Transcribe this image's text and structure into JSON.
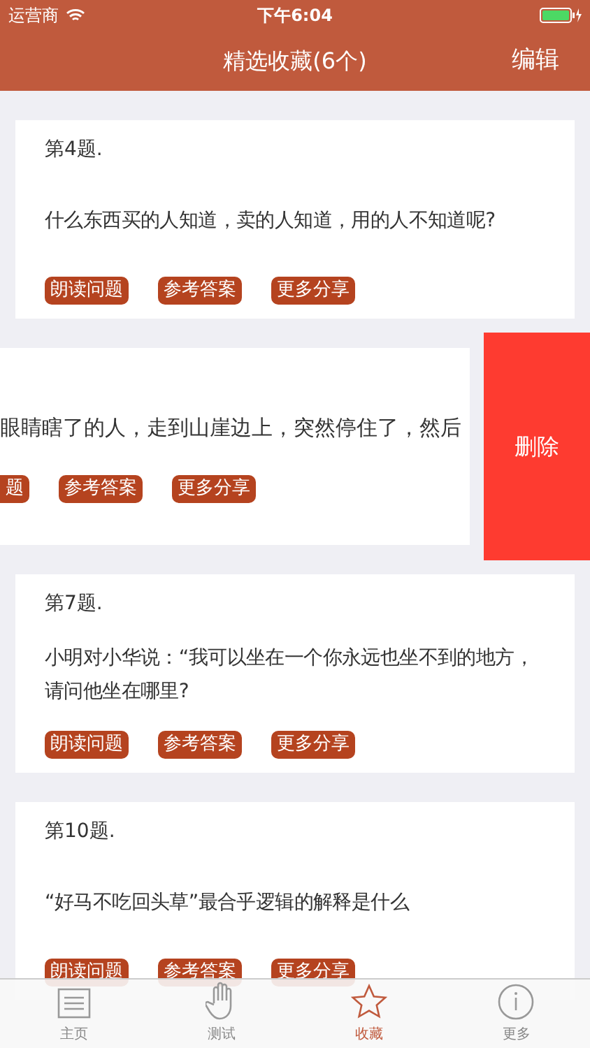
{
  "status_bar": {
    "carrier": "运营商",
    "time": "下午6:04"
  },
  "nav": {
    "title": "精选收藏(6个)",
    "action": "编辑"
  },
  "cards": [
    {
      "swiped": false,
      "title": "第4题.",
      "question": "什么东西买的人知道，卖的人知道，用的人不知道呢?",
      "buttons": [
        "朗读问题",
        "参考答案",
        "更多分享"
      ]
    },
    {
      "swiped": true,
      "question": "眼睛瞎了的人，走到山崖边上，突然停住了，然后",
      "buttons": [
        "题",
        "参考答案",
        "更多分享"
      ],
      "delete_label": "删除"
    },
    {
      "swiped": false,
      "title": "第7题.",
      "question": "小明对小华说：“我可以坐在一个你永远也坐不到的地方，请问他坐在哪里?",
      "buttons": [
        "朗读问题",
        "参考答案",
        "更多分享"
      ]
    },
    {
      "swiped": false,
      "title": "第10题.",
      "question": "“好马不吃回头草”最合乎逻辑的解释是什么",
      "buttons": [
        "朗读问题",
        "参考答案",
        "更多分享"
      ]
    }
  ],
  "tabs": [
    {
      "kind": "home",
      "label": "主页",
      "selected": false
    },
    {
      "kind": "hand",
      "label": "测试",
      "selected": false
    },
    {
      "kind": "star",
      "label": "收藏",
      "selected": true
    },
    {
      "kind": "info",
      "label": "更多",
      "selected": false
    }
  ]
}
